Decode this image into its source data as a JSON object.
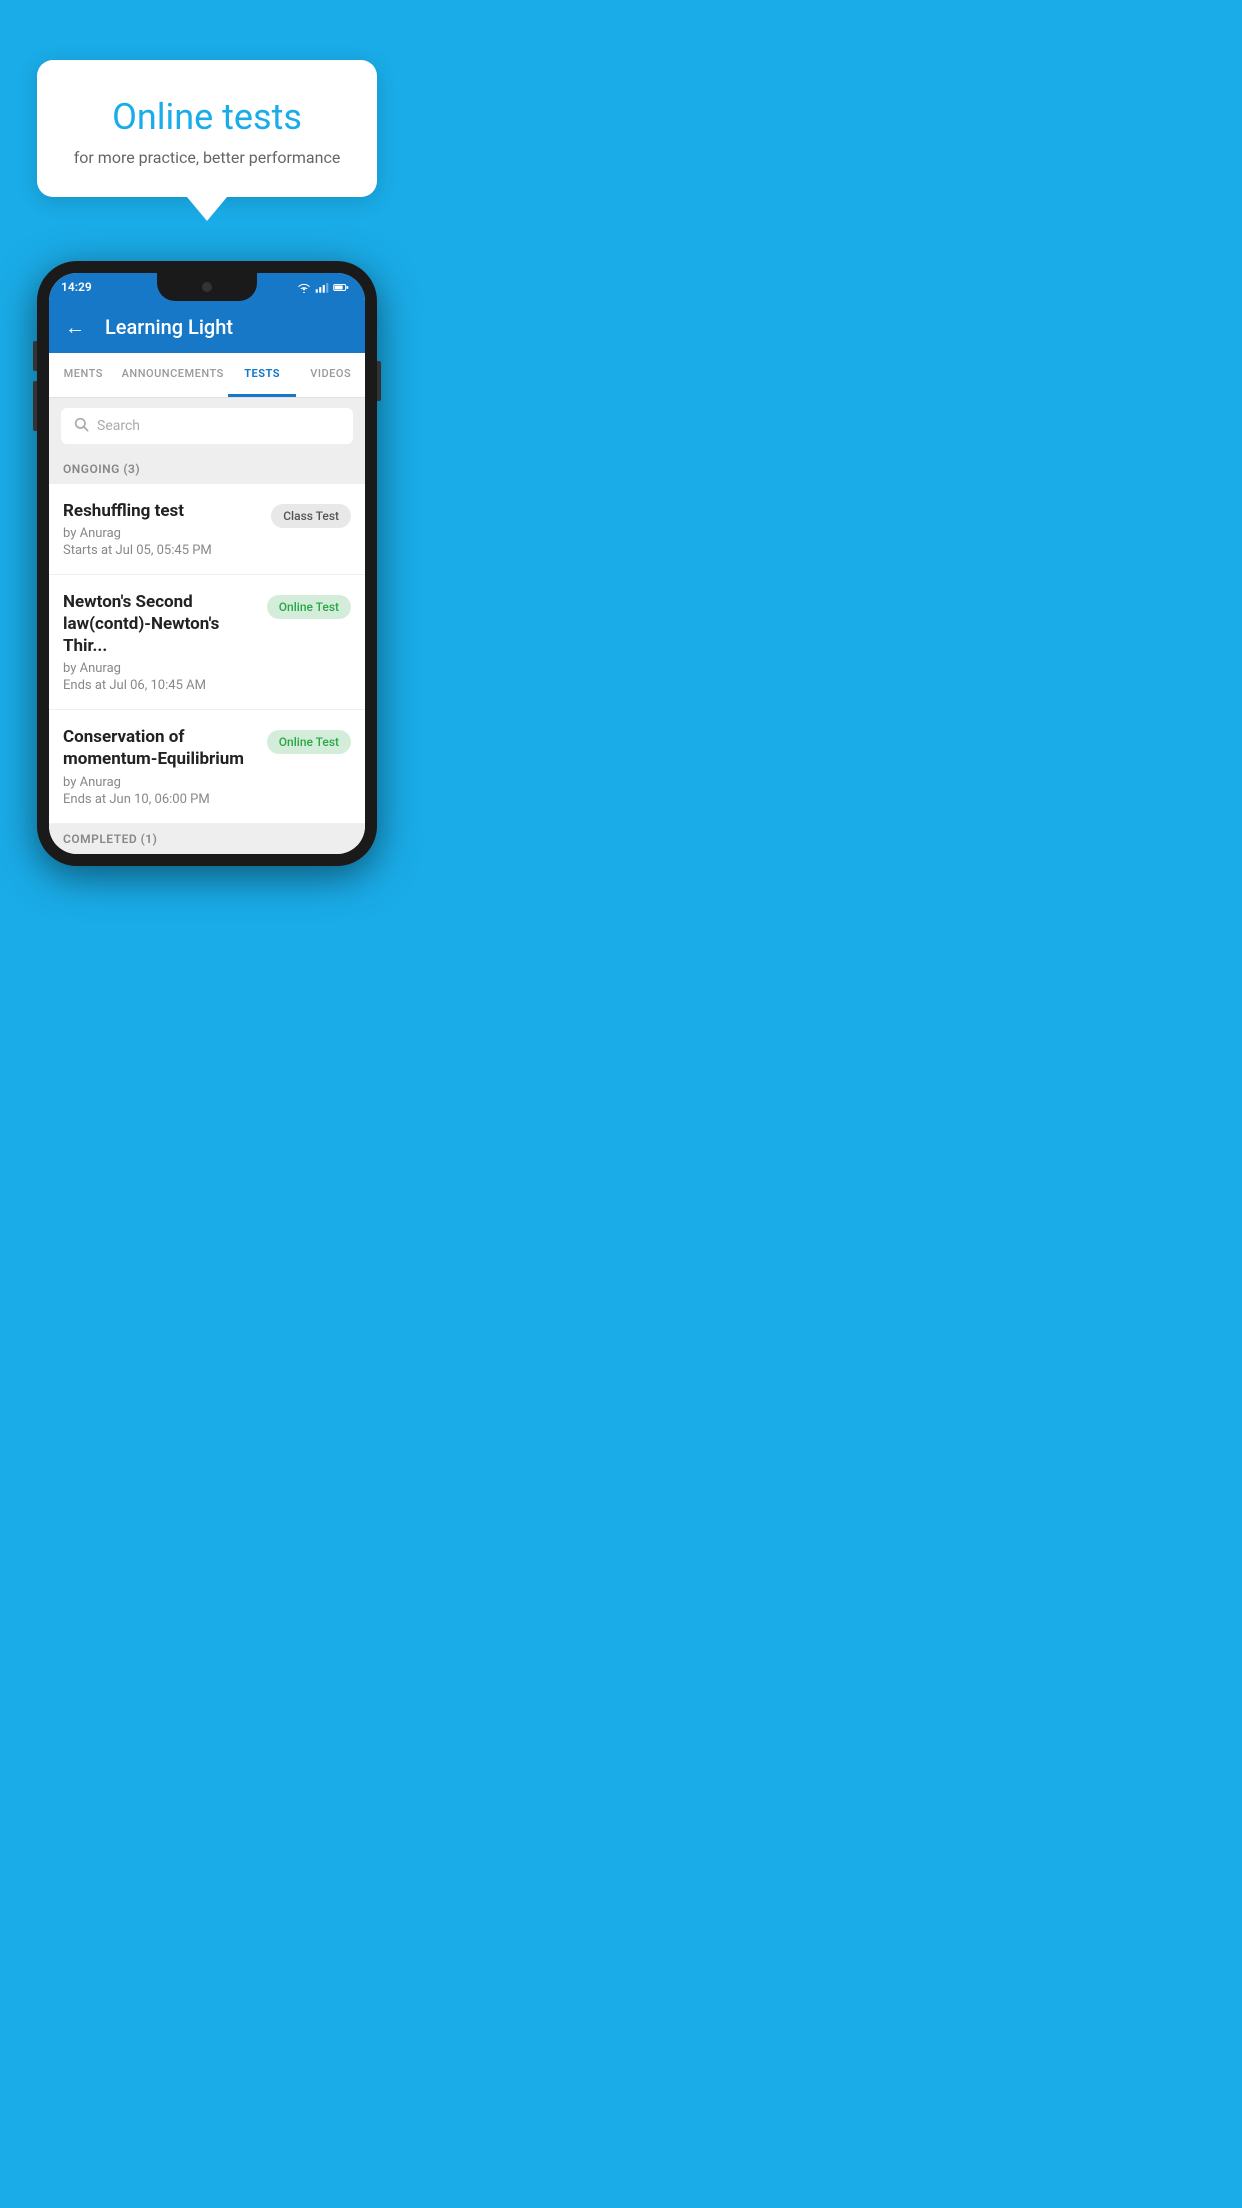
{
  "background_color": "#1AACE8",
  "speech_bubble": {
    "title": "Online tests",
    "subtitle": "for more practice, better performance"
  },
  "phone": {
    "status_bar": {
      "time": "14:29",
      "icons": [
        "wifi",
        "signal",
        "battery"
      ]
    },
    "app_bar": {
      "back_label": "←",
      "title": "Learning Light"
    },
    "tabs": [
      {
        "label": "MENTS",
        "active": false
      },
      {
        "label": "ANNOUNCEMENTS",
        "active": false
      },
      {
        "label": "TESTS",
        "active": true
      },
      {
        "label": "VIDEOS",
        "active": false
      }
    ],
    "search": {
      "placeholder": "Search"
    },
    "ongoing_section": {
      "header": "ONGOING (3)",
      "items": [
        {
          "title": "Reshuffling test",
          "by": "by Anurag",
          "date": "Starts at  Jul 05, 05:45 PM",
          "badge": "Class Test",
          "badge_type": "class"
        },
        {
          "title": "Newton's Second law(contd)-Newton's Thir...",
          "by": "by Anurag",
          "date": "Ends at  Jul 06, 10:45 AM",
          "badge": "Online Test",
          "badge_type": "online"
        },
        {
          "title": "Conservation of momentum-Equilibrium",
          "by": "by Anurag",
          "date": "Ends at  Jun 10, 06:00 PM",
          "badge": "Online Test",
          "badge_type": "online"
        }
      ]
    },
    "completed_section": {
      "header": "COMPLETED (1)"
    }
  }
}
